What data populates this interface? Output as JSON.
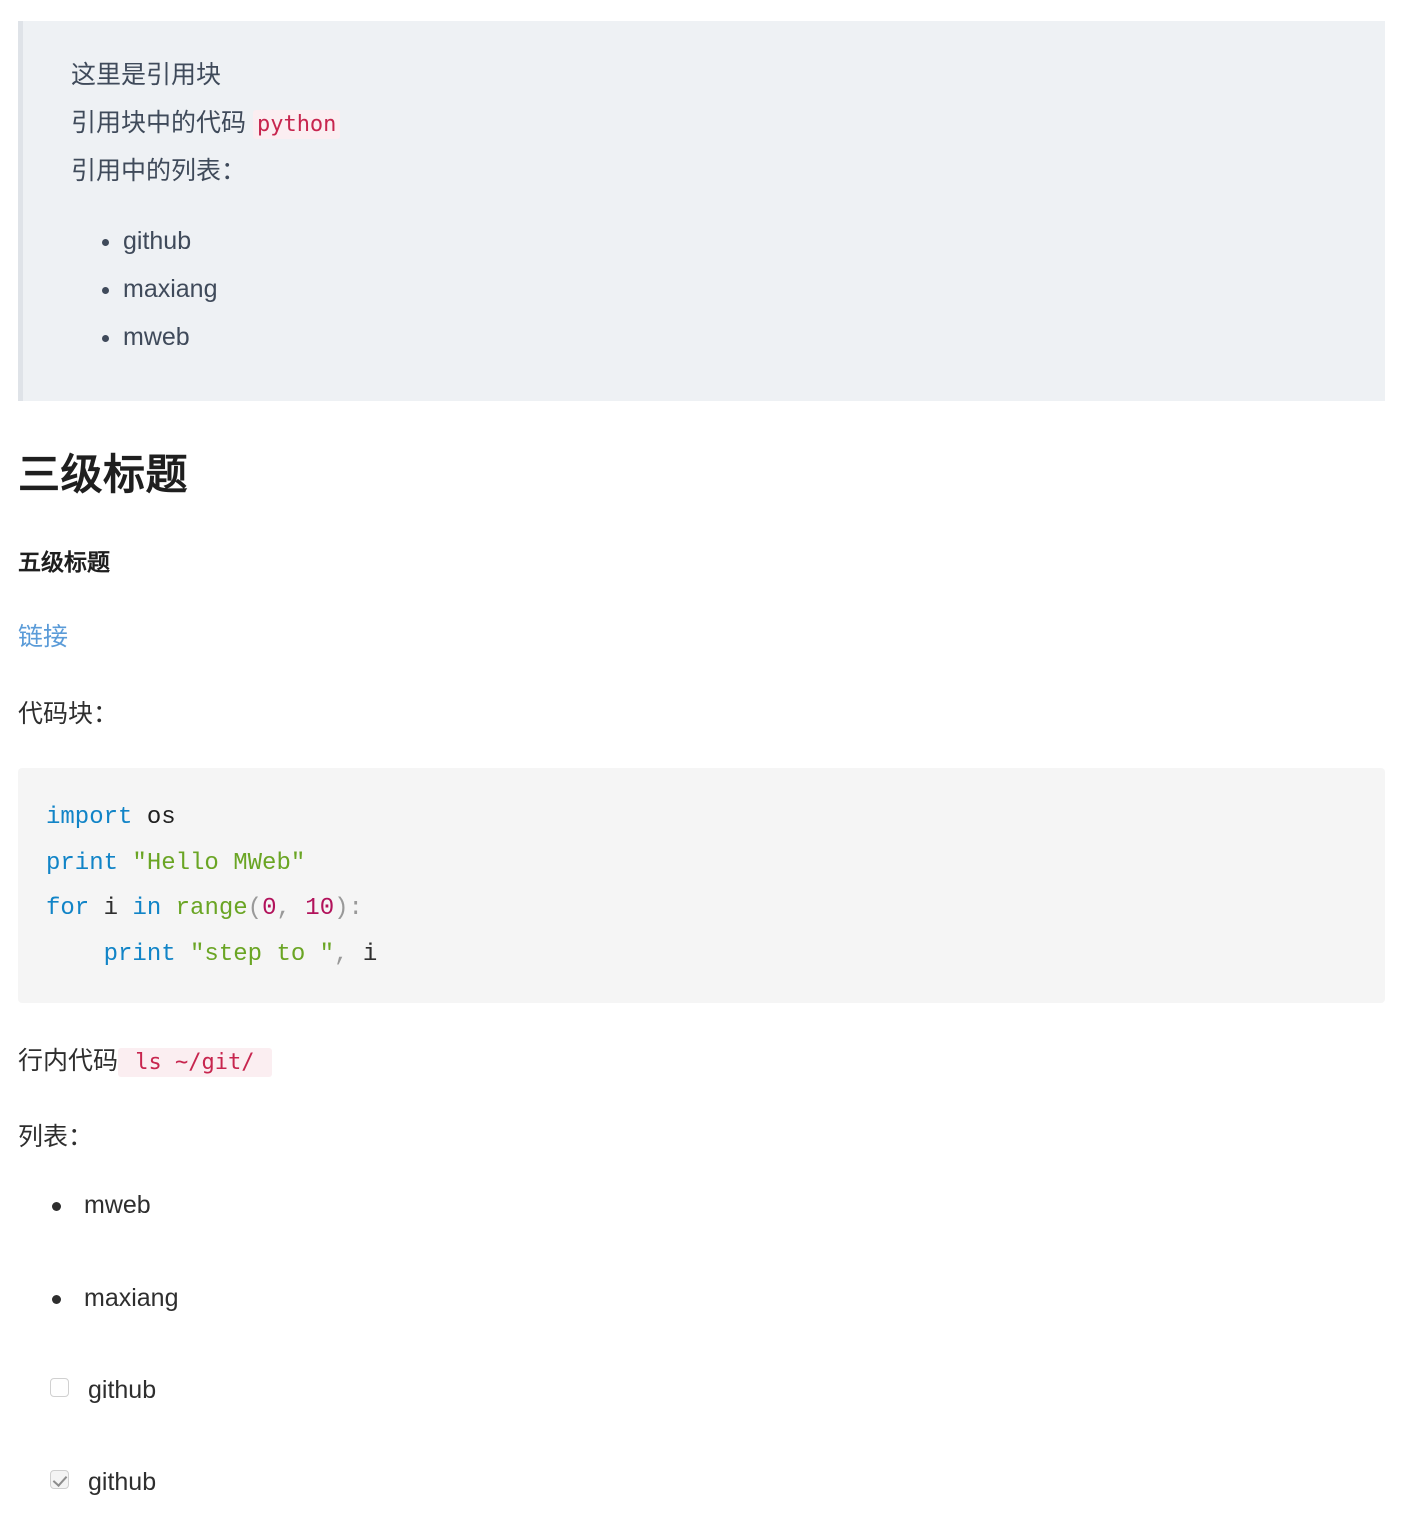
{
  "document": {
    "blockquote": {
      "lines": [
        "这里是引用块",
        "引用块中的代码 ",
        "引用中的列表："
      ],
      "inline_code": "python",
      "list_items": [
        "github",
        "maxiang",
        "mweb"
      ]
    },
    "heading3": "三级标题",
    "heading5": "五级标题",
    "link": {
      "label": "链接",
      "color": "#5a9bd8"
    },
    "code_block_label": "代码块：",
    "code_block": {
      "language": "python",
      "lines": [
        [
          {
            "t": "import",
            "c": "kw"
          },
          {
            "t": " ",
            "c": "plain"
          },
          {
            "t": "os",
            "c": "name"
          }
        ],
        [
          {
            "t": "print",
            "c": "kw"
          },
          {
            "t": " ",
            "c": "plain"
          },
          {
            "t": "\"Hello MWeb\"",
            "c": "str"
          }
        ],
        [
          {
            "t": "for",
            "c": "kw"
          },
          {
            "t": " i ",
            "c": "plain"
          },
          {
            "t": "in",
            "c": "kw"
          },
          {
            "t": " ",
            "c": "plain"
          },
          {
            "t": "range",
            "c": "fn"
          },
          {
            "t": "(",
            "c": "punc"
          },
          {
            "t": "0",
            "c": "num"
          },
          {
            "t": ", ",
            "c": "punc"
          },
          {
            "t": "10",
            "c": "num"
          },
          {
            "t": ")",
            "c": "punc"
          },
          {
            "t": ":",
            "c": "punc"
          }
        ],
        [
          {
            "t": "    ",
            "c": "plain"
          },
          {
            "t": "print",
            "c": "kw"
          },
          {
            "t": " ",
            "c": "plain"
          },
          {
            "t": "\"step to \"",
            "c": "str"
          },
          {
            "t": ",",
            "c": "punc"
          },
          {
            "t": " i",
            "c": "plain"
          }
        ]
      ]
    },
    "inline_code_label": "行内代码",
    "inline_code_value": " ls ~/git/ ",
    "list_label": "列表：",
    "bottom_list": [
      {
        "type": "bullet",
        "label": "mweb",
        "checked": false
      },
      {
        "type": "bullet",
        "label": "maxiang",
        "checked": false
      },
      {
        "type": "task",
        "label": "github",
        "checked": false
      },
      {
        "type": "task",
        "label": "github",
        "checked": true
      }
    ]
  },
  "colors": {
    "blockquote_bg": "#eef1f4",
    "blockquote_border": "#dfe3e8",
    "blockquote_text": "#3f4a5a",
    "code_block_bg": "#f5f5f5",
    "inline_code_text": "#c7254e",
    "inline_code_bg": "#fbeef1",
    "link": "#5a9bd8",
    "keyword": "#1184c7",
    "string": "#6aa524",
    "number": "#b2125b",
    "punctuation": "#999999",
    "body_text": "#2e2e2e"
  }
}
